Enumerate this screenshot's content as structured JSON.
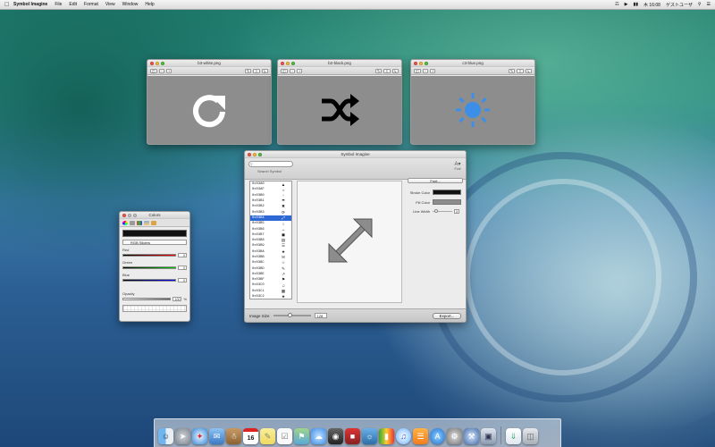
{
  "menubar": {
    "app_name": "Symbol Imagine",
    "items": [
      "File",
      "Edit",
      "Format",
      "View",
      "Window",
      "Help"
    ],
    "clock": "木 16:08",
    "user": "ゲストユーザ"
  },
  "preview_windows": [
    {
      "title": "b3-white.png",
      "icon": "refresh-arrow-icon"
    },
    {
      "title": "b2-black.png",
      "icon": "shuffle-icon"
    },
    {
      "title": "c3-blue.png",
      "icon": "sun-icon"
    }
  ],
  "preview_toolbar": {
    "share": "⇧",
    "page": "↳"
  },
  "symbol_window": {
    "title": "Symbol Imagine",
    "search_placeholder": "",
    "search_label": "Search Symbol",
    "font_label": "Font",
    "symbols": [
      {
        "code": "0x03A0",
        "glyph": "▲"
      },
      {
        "code": "0x03AF",
        "glyph": "☼"
      },
      {
        "code": "0x03B0",
        "glyph": "↑"
      },
      {
        "code": "0x03B1",
        "glyph": "☂"
      },
      {
        "code": "0x03B2",
        "glyph": "✖"
      },
      {
        "code": "0x03B3",
        "glyph": "⟳"
      },
      {
        "code": "0x03B4",
        "glyph": "⤢"
      },
      {
        "code": "0x03B5",
        "glyph": "↕"
      },
      {
        "code": "0x03B6",
        "glyph": "↔"
      },
      {
        "code": "0x03B7",
        "glyph": "◼"
      },
      {
        "code": "0x03B8",
        "glyph": "▤"
      },
      {
        "code": "0x03B9",
        "glyph": "☰"
      },
      {
        "code": "0x03BA",
        "glyph": "★"
      },
      {
        "code": "0x03BB",
        "glyph": "✉"
      },
      {
        "code": "0x03BC",
        "glyph": "☆"
      },
      {
        "code": "0x03BD",
        "glyph": "✎"
      },
      {
        "code": "0x03BE",
        "glyph": "↗"
      },
      {
        "code": "0x03BF",
        "glyph": "⚑"
      },
      {
        "code": "0x03C0",
        "glyph": "♫"
      },
      {
        "code": "0x03C1",
        "glyph": "▦"
      },
      {
        "code": "0x03C2",
        "glyph": "★"
      }
    ],
    "selected_index": 6,
    "font_popup": "Font...",
    "stroke_color_label": "Stroke Color",
    "fill_color_label": "Fill Color",
    "line_width_label": "Line Width",
    "line_width_value": "3",
    "image_size_label": "Image Size",
    "image_size_value": "128",
    "export_label": "Export..."
  },
  "colors_panel": {
    "title": "Colors",
    "mode": "RGB Sliders",
    "red_label": "Red",
    "red_value": "0",
    "green_label": "Green",
    "green_value": "0",
    "blue_label": "Blue",
    "blue_value": "0",
    "opacity_label": "Opacity",
    "opacity_value": "100",
    "opacity_unit": "%"
  },
  "dock_apps": [
    "Finder",
    "Launchpad",
    "Safari",
    "Mail",
    "Contacts",
    "Calendar",
    "Notes",
    "Reminders",
    "Maps",
    "Messages",
    "FaceTime",
    "Photo Booth",
    "iPhoto",
    "Numbers",
    "iTunes",
    "iBooks",
    "App Store",
    "System Preferences",
    "Xcode",
    "Preview",
    "Downloads",
    "Trash"
  ],
  "calendar_day": "16",
  "colors": {
    "accent": "#2e68d4",
    "symbol_gray": "#8c8c8c",
    "sun_blue": "#3d8ee6"
  }
}
